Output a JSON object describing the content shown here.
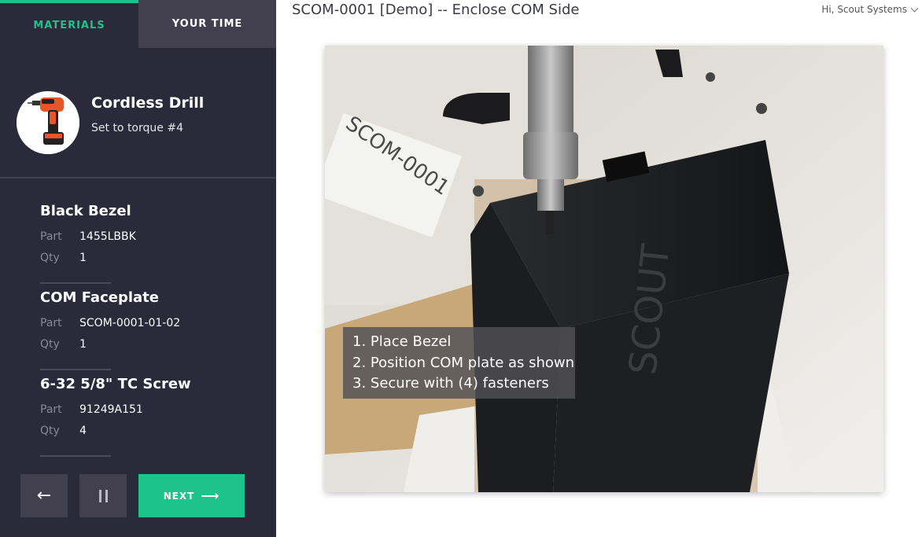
{
  "tabs": {
    "materials": "MATERIALS",
    "time": "YOUR TIME"
  },
  "tool": {
    "name": "Cordless Drill",
    "note": "Set to torque #4",
    "icon": "drill-icon"
  },
  "parts": [
    {
      "name": "Black Bezel",
      "part_label": "Part",
      "part": "1455LBBK",
      "qty_label": "Qty",
      "qty": "1"
    },
    {
      "name": "COM Faceplate",
      "part_label": "Part",
      "part": "SCOM-0001-01-02",
      "qty_label": "Qty",
      "qty": "1"
    },
    {
      "name": "6-32 5/8\" TC Screw",
      "part_label": "Part",
      "part": "91249A151",
      "qty_label": "Qty",
      "qty": "4"
    }
  ],
  "controls": {
    "back": "←",
    "next": "NEXT",
    "next_arrow": "⟶"
  },
  "header": {
    "title": "SCOM-0001 [Demo] -- Enclose COM Side",
    "user": "Hi, Scout Systems"
  },
  "photo": {
    "steps": [
      "1. Place Bezel",
      "2. Position COM plate as shown",
      "3. Secure with (4) fasteners"
    ],
    "label_text": "SCOM-0001",
    "brand_text": "SCOUT"
  },
  "colors": {
    "accent": "#1ec28b",
    "sidebar": "#2b2a3b",
    "sidebar_alt": "#42404f"
  }
}
